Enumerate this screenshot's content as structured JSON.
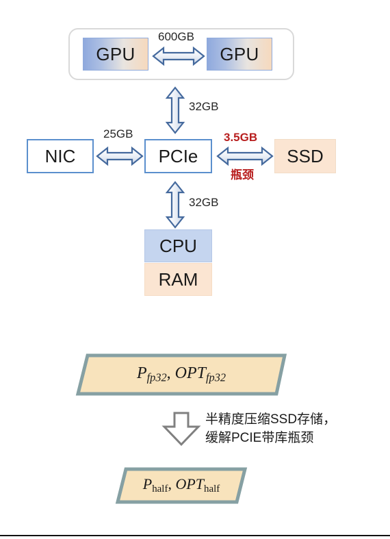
{
  "diagram": {
    "title": "Hardware bandwidth bottleneck diagram",
    "gpu_group": {
      "name": "gpu-pair-container",
      "left_gpu_label": "GPU",
      "right_gpu_label": "GPU",
      "interconnect_label": "600GB"
    },
    "nodes": {
      "nic_label": "NIC",
      "pcie_label": "PCIe",
      "ssd_label": "SSD",
      "cpu_label": "CPU",
      "ram_label": "RAM"
    },
    "links": [
      {
        "id": "gpu-gpu",
        "label": "600GB",
        "highlight": false,
        "orientation": "horizontal"
      },
      {
        "id": "gpu-pcie",
        "label": "32GB",
        "highlight": false,
        "orientation": "vertical"
      },
      {
        "id": "nic-pcie",
        "label": "25GB",
        "highlight": false,
        "orientation": "horizontal"
      },
      {
        "id": "pcie-ssd",
        "label": "3.5GB",
        "highlight": true,
        "orientation": "horizontal"
      },
      {
        "id": "pcie-cpu",
        "label": "32GB",
        "highlight": false,
        "orientation": "vertical"
      }
    ],
    "labels": {
      "gpu_gpu_bw": "600GB",
      "gpu_pcie_bw": "32GB",
      "nic_pcie_bw": "25GB",
      "pcie_ssd_bw": "3.5GB",
      "pcie_ssd_note": "瓶颈",
      "pcie_cpu_bw": "32GB"
    }
  },
  "flow": {
    "source_formula": {
      "p_symbol": "P",
      "p_subscript": "fp32",
      "separator": ",",
      "opt_symbol": "OPT",
      "opt_subscript": "fp32"
    },
    "target_formula": {
      "p_symbol": "P",
      "p_subscript": "half",
      "separator": ",",
      "opt_symbol": "OPT",
      "opt_subscript": "half"
    },
    "annotation_line1": "半精度压缩SSD存储，",
    "annotation_line2": "缓解PCIE带库瓶颈"
  },
  "colors": {
    "accent_blue": "#5b8fcd",
    "arrow_blue": "#44699d",
    "highlight_red": "#b81f1f",
    "peach_fill": "#fbe5d2",
    "cpu_fill": "#c5d5ef",
    "trapezoid_fill": "#f8e3bc",
    "trapezoid_border": "#86a0a3",
    "gray_arrow": "#808080"
  }
}
